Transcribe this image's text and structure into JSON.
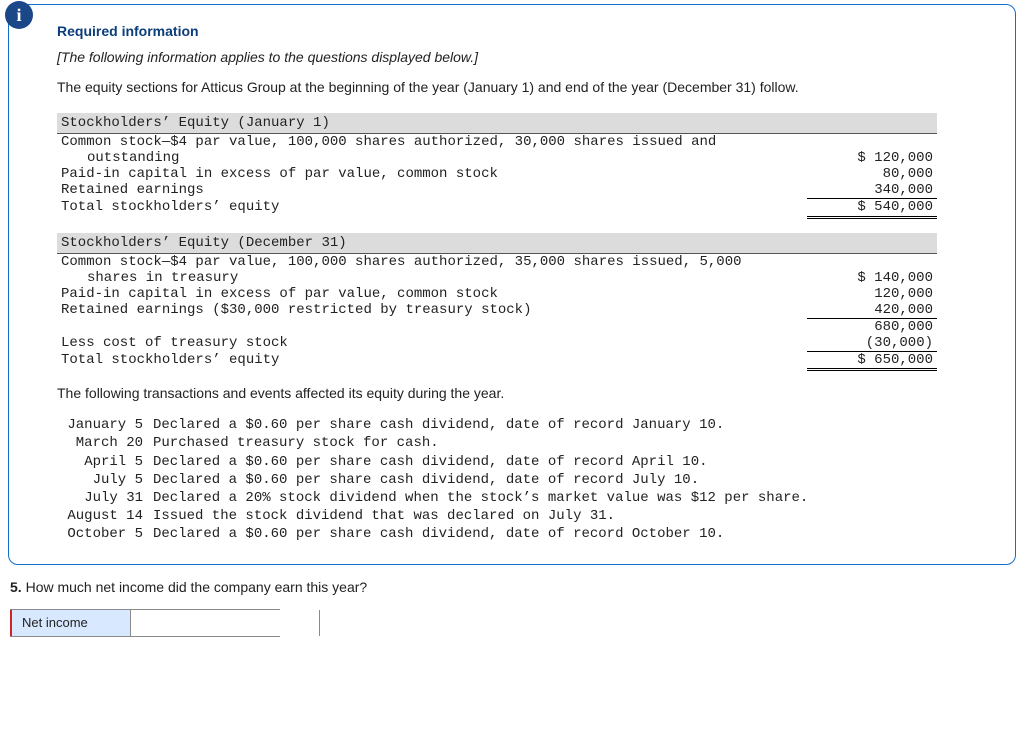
{
  "info_badge": "i",
  "required_info": "Required information",
  "context_note": "[The following information applies to the questions displayed below.]",
  "lead": "The equity sections for Atticus Group at the beginning of the year (January 1) and end of the year (December 31) follow.",
  "jan1": {
    "header": "Stockholders’ Equity (January 1)",
    "r1l": "Common stock—$4 par value, 100,000 shares authorized, 30,000 shares issued and",
    "r1c": "outstanding",
    "r1v": "$ 120,000",
    "r2l": "Paid-in capital in excess of par value, common stock",
    "r2v": "80,000",
    "r3l": "Retained earnings",
    "r3v": "340,000",
    "totl": "Total stockholders’ equity",
    "totv": "$ 540,000"
  },
  "dec31": {
    "header": "Stockholders’ Equity (December 31)",
    "r1l": "Common stock—$4 par value, 100,000 shares authorized, 35,000 shares issued, 5,000",
    "r1c": "shares in treasury",
    "r1v": "$ 140,000",
    "r2l": "Paid-in capital in excess of par value, common stock",
    "r2v": "120,000",
    "r3l": "Retained earnings ($30,000 restricted by treasury stock)",
    "r3v": "420,000",
    "subv": "680,000",
    "lessl": "Less cost of treasury stock",
    "lessv": "(30,000)",
    "totl": "Total stockholders’ equity",
    "totv": "$ 650,000"
  },
  "mid": "The following transactions and events affected its equity during the year.",
  "tx": [
    {
      "date": "January 5",
      "desc": "Declared a $0.60 per share cash dividend, date of record January 10."
    },
    {
      "date": "March 20",
      "desc": "Purchased treasury stock for cash."
    },
    {
      "date": "April 5",
      "desc": "Declared a $0.60 per share cash dividend, date of record April 10."
    },
    {
      "date": "July 5",
      "desc": "Declared a $0.60 per share cash dividend, date of record July 10."
    },
    {
      "date": "July 31",
      "desc": "Declared a 20% stock dividend when the stock’s market value was $12 per share."
    },
    {
      "date": "August 14",
      "desc": "Issued the stock dividend that was declared on July 31."
    },
    {
      "date": "October 5",
      "desc": "Declared a $0.60 per share cash dividend, date of record October 10."
    }
  ],
  "q5_num": "5.",
  "q5_text": " How much net income did the company earn this year?",
  "answer_label": "Net income",
  "answer_value": ""
}
